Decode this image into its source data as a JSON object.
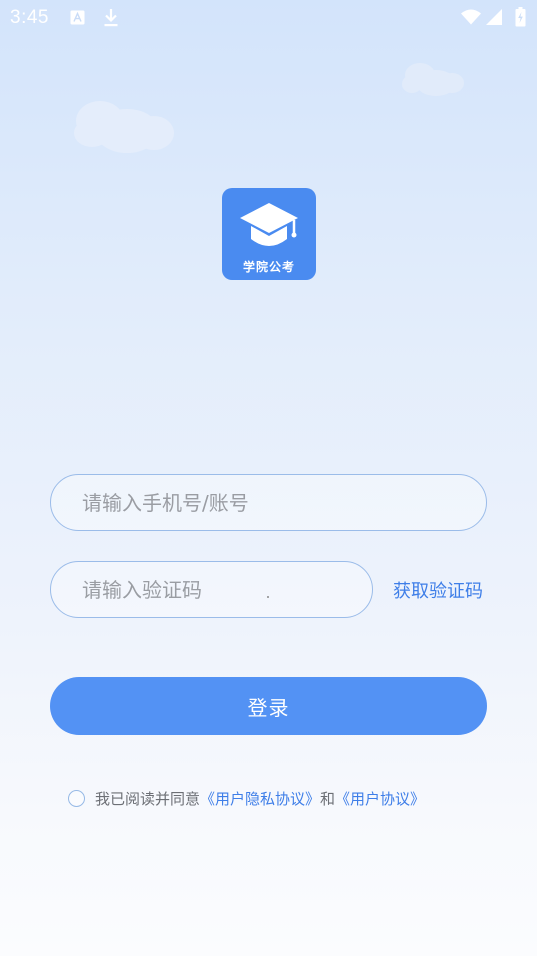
{
  "status_bar": {
    "time": "3:45",
    "icons": [
      "font-notification-icon",
      "download-icon",
      "wifi-icon",
      "cellular-signal-icon",
      "battery-icon"
    ]
  },
  "logo": {
    "icon": "graduation-cap-icon",
    "text": "学院公考",
    "color": "#4a8bf0"
  },
  "form": {
    "account_placeholder": "请输入手机号/账号",
    "code_placeholder": "请输入验证码",
    "get_code_label": "获取验证码",
    "login_label": "登录"
  },
  "agreement": {
    "prefix": "我已阅读并同意",
    "privacy_link": "《用户隐私协议》",
    "and": "和",
    "user_link": "《用户协议》",
    "checked": false
  },
  "colors": {
    "accent": "#5392f4",
    "link": "#3e7ee8",
    "field_border": "#9bbce9"
  }
}
